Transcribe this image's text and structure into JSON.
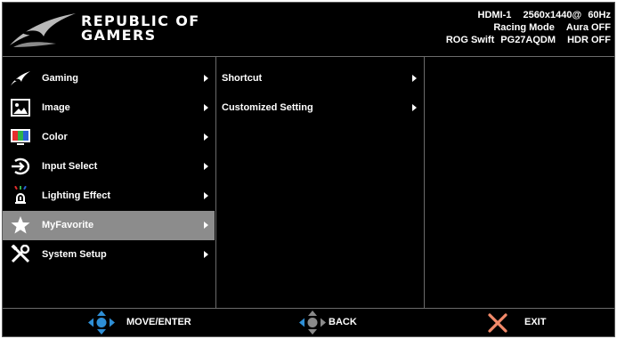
{
  "header": {
    "brand_line1": "REPUBLIC OF",
    "brand_line2": "GAMERS",
    "status": {
      "input": "HDMI-1",
      "resolution": "2560x1440@",
      "refresh": "60Hz",
      "mode_label": "Racing Mode",
      "aura": "Aura OFF",
      "model_prefix": "ROG Swift",
      "model": "PG27AQDM",
      "hdr": "HDR OFF"
    }
  },
  "menu": {
    "items": [
      {
        "label": "Gaming",
        "icon": "rog-eye-icon"
      },
      {
        "label": "Image",
        "icon": "image-icon"
      },
      {
        "label": "Color",
        "icon": "color-icon"
      },
      {
        "label": "Input Select",
        "icon": "input-select-icon"
      },
      {
        "label": "Lighting Effect",
        "icon": "lighting-effect-icon"
      },
      {
        "label": "MyFavorite",
        "icon": "star-icon",
        "selected": true
      },
      {
        "label": "System Setup",
        "icon": "tools-icon"
      }
    ]
  },
  "submenu": {
    "items": [
      {
        "label": "Shortcut"
      },
      {
        "label": "Customized Setting"
      }
    ]
  },
  "footer": {
    "move_label": "MOVE/ENTER",
    "back_label": "BACK",
    "exit_label": "EXIT"
  },
  "colors": {
    "background": "#000000",
    "selected": "#8c8c8c",
    "divider": "#6b6b6b",
    "joystick": "#2e8fd6",
    "exit_x": "#f28a6a"
  }
}
